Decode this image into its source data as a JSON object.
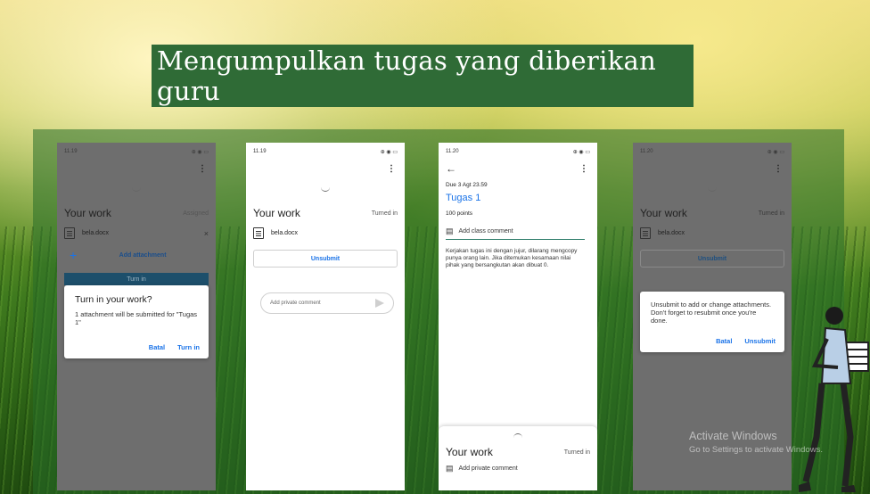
{
  "title": "Mengumpulkan tugas yang diberikan  guru",
  "phone1": {
    "time": "11.19",
    "status_right": "⊕ ◉ ▭",
    "work_title": "Your work",
    "work_status": "Assigned",
    "file": "bela.docx",
    "add_attachment": "Add attachment",
    "turn_in_bar": "Turn in",
    "dialog_title": "Turn in your work?",
    "dialog_body": "1 attachment will be submitted for \"Tugas 1\"",
    "cancel": "Batal",
    "confirm": "Turn in"
  },
  "phone2": {
    "time": "11.19",
    "status_right": "⊕ ◉ ▭",
    "work_title": "Your work",
    "work_status": "Turned in",
    "file": "bela.docx",
    "unsubmit": "Unsubmit",
    "comment_placeholder": "Add private comment"
  },
  "phone3": {
    "time": "11.20",
    "status_right": "⊕ ◉ ▭",
    "due": "Due 3 Agt 23.59",
    "assignment_title": "Tugas 1",
    "points": "100 points",
    "class_comment": "Add class comment",
    "description": "Kerjakan tugas ini dengan jujur, dilarang mengcopy punya orang lain. Jika ditemukan kesamaan nilai pihak yang bersangkutan akan dibuat 0.",
    "work_title": "Your work",
    "work_status": "Turned in",
    "private_comment": "Add private comment"
  },
  "phone4": {
    "time": "11.20",
    "status_right": "⊕ ◉ ▭",
    "work_title": "Your work",
    "work_status": "Turned in",
    "file": "bela.docx",
    "unsubmit": "Unsubmit",
    "dialog_body": "Unsubmit to add or change attachments. Don't forget to resubmit once you're done.",
    "cancel": "Batal",
    "confirm": "Unsubmit"
  },
  "watermark": {
    "line1": "Activate Windows",
    "line2": "Go to Settings to activate Windows."
  },
  "colors": {
    "title_bg": "#2f6b36",
    "accent_blue": "#1a73e8",
    "dim_overlay": "#6e6e6e"
  }
}
